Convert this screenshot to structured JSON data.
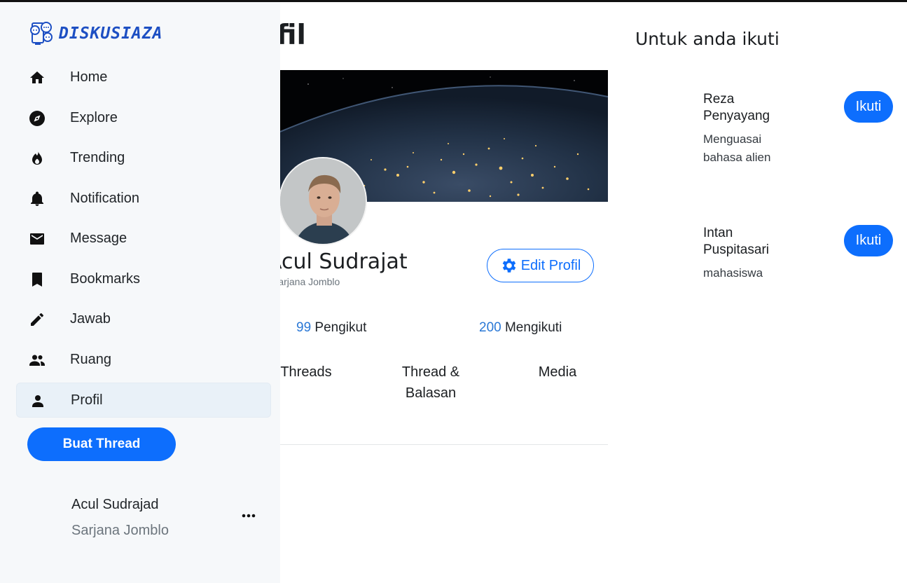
{
  "app": {
    "logo_text": "DISKUSIAZA"
  },
  "sidebar": {
    "items": [
      {
        "label": "Home",
        "icon": "home-icon"
      },
      {
        "label": "Explore",
        "icon": "compass-icon"
      },
      {
        "label": "Trending",
        "icon": "flame-icon"
      },
      {
        "label": "Notification",
        "icon": "bell-icon"
      },
      {
        "label": "Message",
        "icon": "envelope-icon"
      },
      {
        "label": "Bookmarks",
        "icon": "bookmark-icon"
      },
      {
        "label": "Jawab",
        "icon": "pencil-icon"
      },
      {
        "label": "Ruang",
        "icon": "people-icon"
      },
      {
        "label": "Profil",
        "icon": "person-icon",
        "active": true
      }
    ],
    "create_button": "Buat Thread",
    "user": {
      "name": "Acul Sudrajad",
      "status": "Sarjana Jomblo"
    }
  },
  "main": {
    "page_title": "Profil",
    "profile": {
      "name": "Acul Sudrajat",
      "status": "Sarjana Jomblo",
      "edit_button": "Edit Profil",
      "followers_count": "99",
      "followers_label": "Pengikut",
      "following_count": "200",
      "following_label": "Mengikuti"
    },
    "tabs": [
      {
        "label": "Threads"
      },
      {
        "label": "Thread & Balasan"
      },
      {
        "label": "Media"
      }
    ]
  },
  "right": {
    "title": "Untuk anda ikuti",
    "suggestions": [
      {
        "name": "Reza Penyayang",
        "desc": "Menguasai bahasa alien",
        "button": "Ikuti"
      },
      {
        "name": "Intan Puspitasari",
        "desc": "mahasiswa",
        "button": "Ikuti"
      }
    ]
  },
  "colors": {
    "accent": "#0d6efd",
    "link": "#2a78d6",
    "sidebar_bg": "#f6f8fa",
    "logo": "#1d4fc3"
  }
}
